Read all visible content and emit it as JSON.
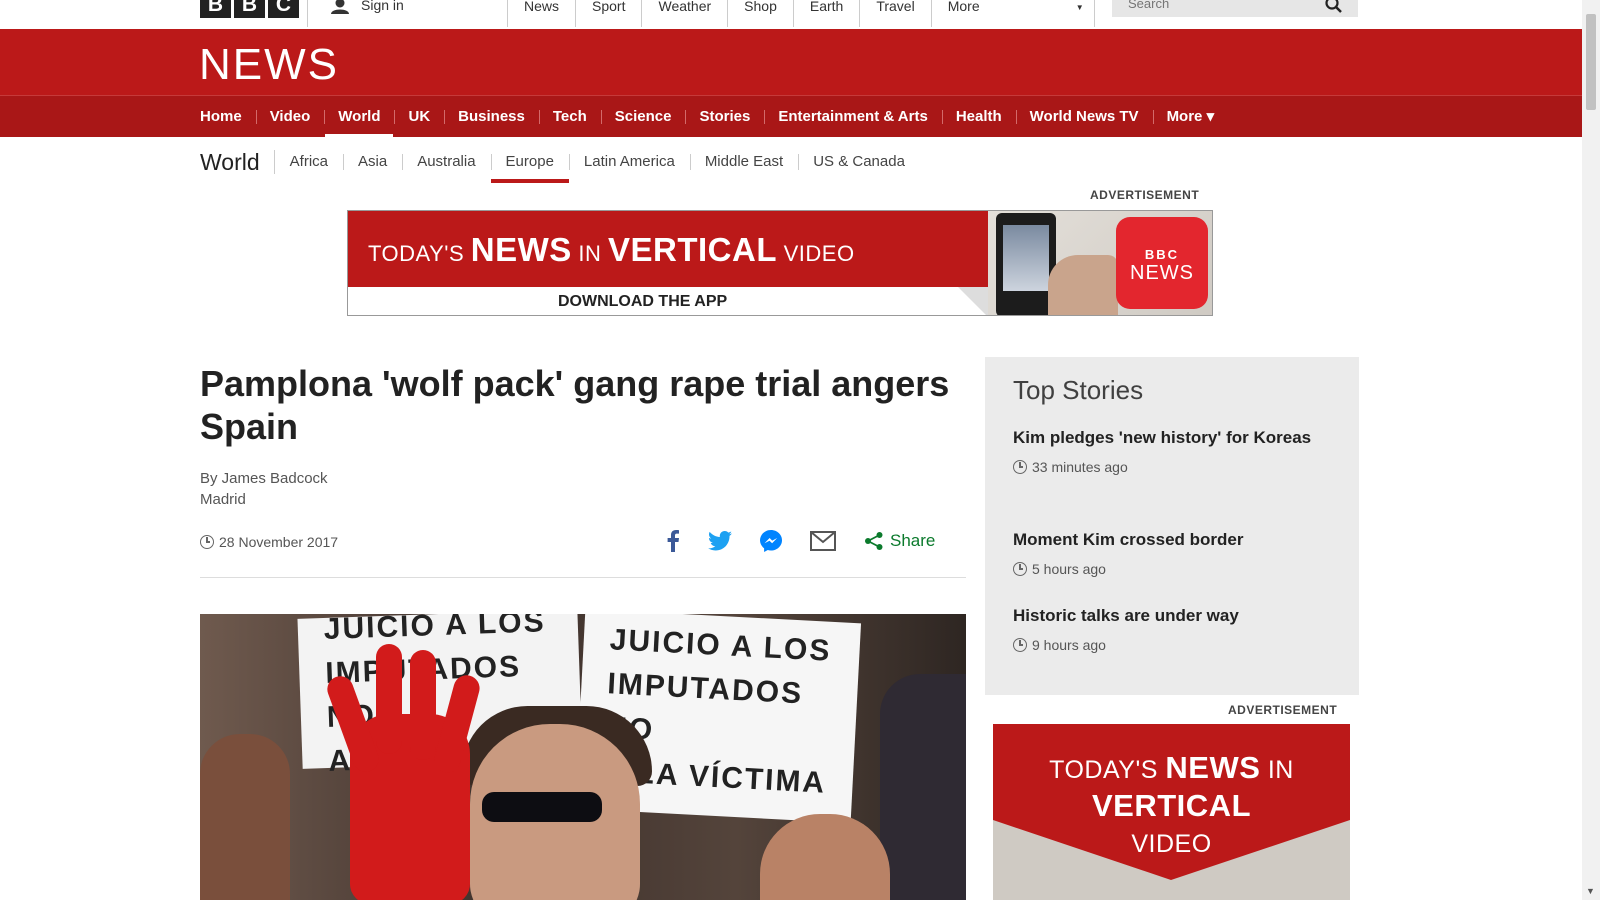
{
  "brand": {
    "logo_letters": [
      "B",
      "B",
      "C"
    ],
    "section_logo": "NEWS"
  },
  "topbar": {
    "sign_in": "Sign in",
    "nav": [
      "News",
      "Sport",
      "Weather",
      "Shop",
      "Earth",
      "Travel"
    ],
    "more": "More",
    "search_placeholder": "Search"
  },
  "main_nav": {
    "items": [
      "Home",
      "Video",
      "World",
      "UK",
      "Business",
      "Tech",
      "Science",
      "Stories",
      "Entertainment & Arts",
      "Health",
      "World News TV",
      "More ▾"
    ],
    "active": "World"
  },
  "sub_nav": {
    "title": "World",
    "items": [
      "Africa",
      "Asia",
      "Australia",
      "Europe",
      "Latin America",
      "Middle East",
      "US & Canada"
    ],
    "active": "Europe"
  },
  "top_ad": {
    "label": "ADVERTISEMENT",
    "headline_parts": [
      "TODAY'S ",
      "NEWS",
      " IN ",
      "VERTICAL",
      " VIDEO"
    ],
    "cta": "DOWNLOAD THE APP",
    "badge_top": "BBC",
    "badge_bottom": "NEWS"
  },
  "article": {
    "headline": "Pamplona 'wolf pack' gang rape trial angers Spain",
    "author": "By James Badcock",
    "location": "Madrid",
    "date": "28 November 2017",
    "share_label": "Share",
    "photo_sign_left": "JUICIO A LOS\nIMPUTADOS NO\nA LA VÍCTIMA",
    "photo_sign_right": "JUICIO A LOS\nIMPUTADOS NO\nA LA VÍCTIMA"
  },
  "top_stories": {
    "title": "Top Stories",
    "items": [
      {
        "title": "Kim pledges 'new history' for Koreas",
        "time": "33 minutes ago"
      },
      {
        "title": "Moment Kim crossed border",
        "time": "5 hours ago"
      },
      {
        "title": "Historic talks are under way",
        "time": "9 hours ago"
      }
    ]
  },
  "side_ad": {
    "label": "ADVERTISEMENT",
    "line1_parts": [
      "TODAY'S ",
      "NEWS",
      " IN"
    ],
    "line2": "VERTICAL",
    "line3": "VIDEO"
  },
  "colors": {
    "brand_red": "#bb1919",
    "nav_red": "#a91717",
    "share_green": "#0b7a2c",
    "facebook": "#3b5998",
    "twitter": "#1da1f2",
    "messenger": "#0084ff"
  }
}
